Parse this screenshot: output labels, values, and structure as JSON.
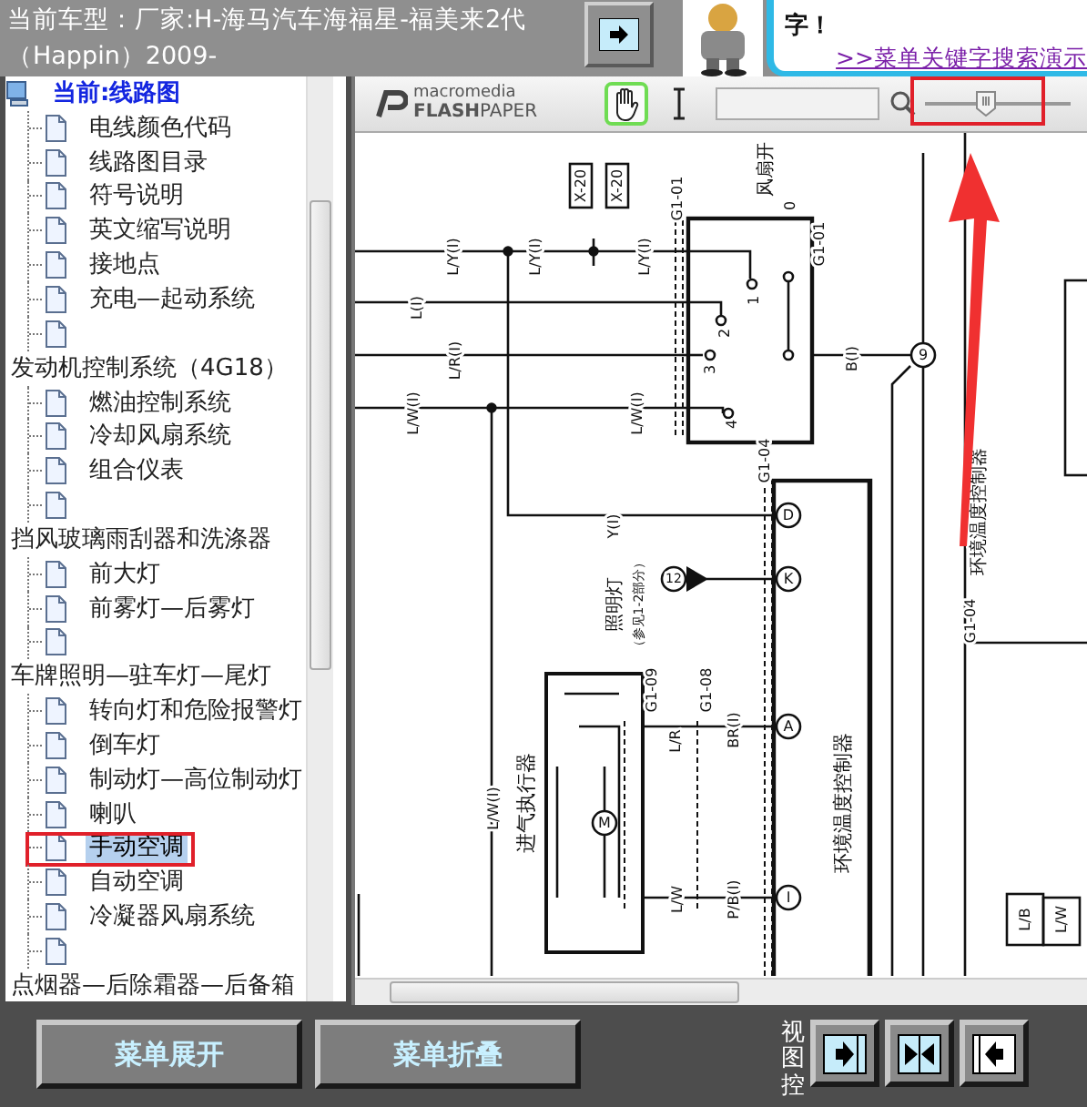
{
  "header": {
    "title": "当前车型：厂家:H-海马汽车海福星-福美来2代（Happin）2009-",
    "bubble_text": "字！",
    "bubble_link": ">>菜单关键字搜索演示"
  },
  "tree": {
    "items": [
      {
        "label": "当前:线路图",
        "kind": "root",
        "selected": false,
        "children": [
          {
            "label": "电线颜色代码",
            "kind": "page",
            "selected": false
          },
          {
            "label": "线路图目录",
            "kind": "page",
            "selected": false
          },
          {
            "label": "符号说明",
            "kind": "page",
            "selected": false
          },
          {
            "label": "英文缩写说明",
            "kind": "page",
            "selected": false
          },
          {
            "label": "接地点",
            "kind": "page",
            "selected": false
          },
          {
            "label": "充电—起动系统",
            "kind": "page",
            "selected": false
          },
          {
            "kind": "page",
            "selected": false
          }
        ]
      },
      {
        "label": "发动机控制系统（4G18）",
        "kind": "group",
        "selected": false,
        "children": [
          {
            "label": "燃油控制系统",
            "kind": "page",
            "selected": false
          },
          {
            "label": "冷却风扇系统",
            "kind": "page",
            "selected": false
          },
          {
            "label": "组合仪表",
            "kind": "page",
            "selected": false
          },
          {
            "kind": "page",
            "selected": false
          }
        ]
      },
      {
        "label": "挡风玻璃雨刮器和洗涤器",
        "kind": "group",
        "selected": false,
        "children": [
          {
            "label": "前大灯",
            "kind": "page",
            "selected": false
          },
          {
            "label": "前雾灯—后雾灯",
            "kind": "page",
            "selected": false
          },
          {
            "kind": "page",
            "selected": false
          }
        ]
      },
      {
        "label": "车牌照明—驻车灯—尾灯",
        "kind": "group",
        "selected": false,
        "children": [
          {
            "label": "转向灯和危险报警灯",
            "kind": "page",
            "selected": false
          },
          {
            "label": "倒车灯",
            "kind": "page",
            "selected": false
          },
          {
            "label": "制动灯—高位制动灯",
            "kind": "page",
            "selected": false
          },
          {
            "label": "喇叭",
            "kind": "page",
            "selected": false
          },
          {
            "label": "手动空调",
            "kind": "page",
            "selected": true,
            "annotated": true
          },
          {
            "label": "自动空调",
            "kind": "page",
            "selected": false
          },
          {
            "label": "冷凝器风扇系统",
            "kind": "page",
            "selected": false
          },
          {
            "kind": "page",
            "selected": false
          }
        ]
      },
      {
        "label": "点烟器—后除霜器—后备箱",
        "kind": "group",
        "selected": false
      }
    ]
  },
  "viewer": {
    "logo_top": "macromedia",
    "logo_bottom": "**FLASH**PAPER",
    "tools": [
      {
        "kind": "hand",
        "selected": true
      },
      {
        "kind": "text",
        "selected": false
      }
    ],
    "zoom": {
      "level": 0.41,
      "annotated": true
    }
  },
  "diagram": {
    "labels": [
      {
        "text": "风扇开",
        "kind": "text"
      },
      {
        "text": "X-20",
        "kind": "text"
      },
      {
        "text": "X-20",
        "kind": "text"
      },
      {
        "text": "G1-01",
        "kind": "text"
      },
      {
        "text": "L/Y(I)",
        "kind": "text"
      },
      {
        "text": "L/Y(I)",
        "kind": "text"
      },
      {
        "text": "L/Y(I)",
        "kind": "text"
      },
      {
        "text": "L(I)",
        "kind": "text"
      },
      {
        "text": "L/R(I)",
        "kind": "text"
      },
      {
        "text": "L/W(I)",
        "kind": "text"
      },
      {
        "text": "L/W(I)",
        "kind": "text"
      },
      {
        "text": "1",
        "kind": "text"
      },
      {
        "text": "2",
        "kind": "text"
      },
      {
        "text": "3",
        "kind": "text"
      },
      {
        "text": "4",
        "kind": "text"
      },
      {
        "text": "0",
        "kind": "text"
      },
      {
        "text": "G1-01",
        "kind": "text"
      },
      {
        "text": "B(I)",
        "kind": "text"
      },
      {
        "text": "9",
        "kind": "pin"
      },
      {
        "text": "G1-04",
        "kind": "text"
      },
      {
        "text": "环境温度控制器",
        "kind": "text"
      },
      {
        "text": "D",
        "kind": "pin"
      },
      {
        "text": "Y(I)",
        "kind": "text"
      },
      {
        "text": "照明灯",
        "kind": "text"
      },
      {
        "text": "（参见1-2部分）",
        "kind": "text"
      },
      {
        "text": "12",
        "kind": "pin"
      },
      {
        "text": "K",
        "kind": "pin"
      },
      {
        "text": "G1-09",
        "kind": "text"
      },
      {
        "text": "G1-08",
        "kind": "text"
      },
      {
        "text": "L/R",
        "kind": "text"
      },
      {
        "text": "BR(I)",
        "kind": "text"
      },
      {
        "text": "A",
        "kind": "pin"
      },
      {
        "text": "环境温度控制器",
        "kind": "text"
      },
      {
        "text": "L/W(I)",
        "kind": "text"
      },
      {
        "text": "进气执行器",
        "kind": "text"
      },
      {
        "text": "M",
        "kind": "pin"
      },
      {
        "text": "L/W",
        "kind": "text"
      },
      {
        "text": "P/B(I)",
        "kind": "text"
      },
      {
        "text": "I",
        "kind": "pin"
      },
      {
        "text": "G1-04",
        "kind": "text"
      },
      {
        "text": "L/B",
        "kind": "text"
      },
      {
        "text": "L/W",
        "kind": "text"
      }
    ]
  },
  "footer": {
    "buttons": [
      "菜单展开",
      "菜单折叠"
    ],
    "view_label": "视图控",
    "view_buttons": [
      {
        "kind": "right"
      },
      {
        "kind": "both"
      },
      {
        "kind": "left"
      }
    ]
  }
}
